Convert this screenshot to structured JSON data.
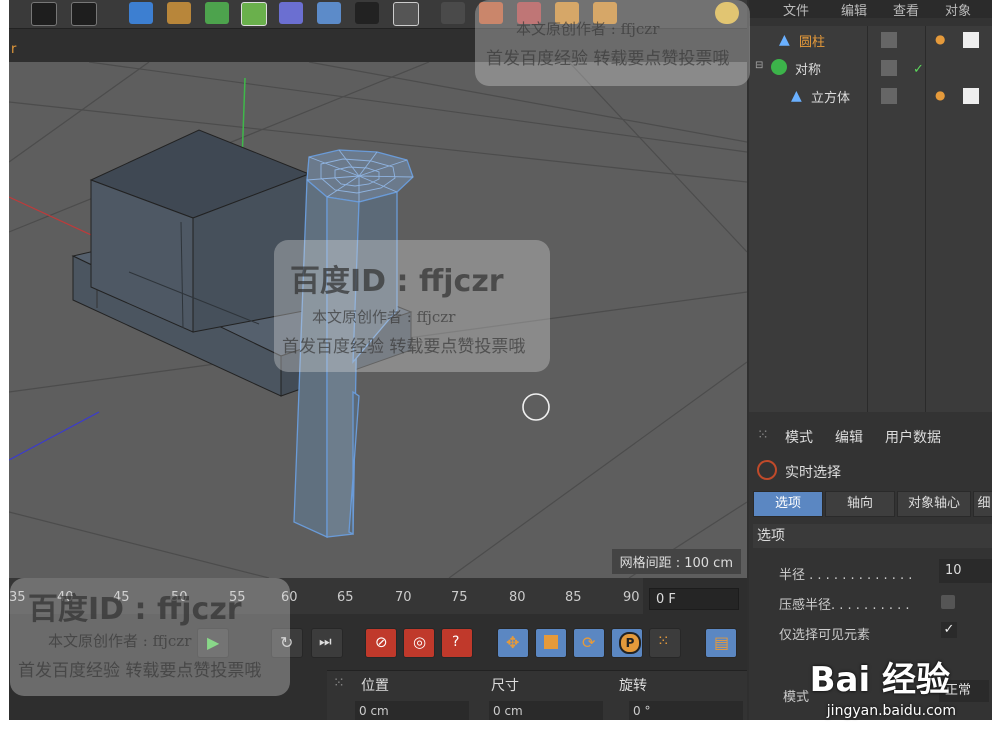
{
  "viewport": {
    "label": "r",
    "grid_spacing_text": "网格间距 : 100 cm"
  },
  "object_manager": {
    "menu": [
      "文件",
      "编辑",
      "查看",
      "对象"
    ],
    "objects": [
      {
        "name": "圆柱",
        "highlighted": true,
        "indent": 1
      },
      {
        "name": "对称",
        "highlighted": false,
        "indent": 0
      },
      {
        "name": "立方体",
        "highlighted": false,
        "indent": 1
      }
    ]
  },
  "attributes": {
    "menu": [
      "模式",
      "编辑",
      "用户数据"
    ],
    "tool_title": "实时选择",
    "tabs": [
      "选项",
      "轴向",
      "对象轴心",
      "细"
    ],
    "section_title": "选项",
    "radius_label": "半径 . . . . . . . . . . . . .",
    "radius_value": "10",
    "pressure_label": "压感半径. . . . . . . . . .",
    "visible_only_label": "仅选择可见元素",
    "mode_label": "模式",
    "mode_value": "正常"
  },
  "timeline": {
    "ticks": [
      "35",
      "40",
      "45",
      "50",
      "55",
      "60",
      "65",
      "70",
      "75",
      "80",
      "85",
      "90"
    ],
    "current_frame": "0 F"
  },
  "coordinates": {
    "headers": [
      "位置",
      "尺寸",
      "旋转"
    ],
    "position_x": "0 cm",
    "size_x": "0 cm",
    "rotation_h": "0 °"
  },
  "watermark": {
    "title": "百度ID : ffjczr",
    "author": "本文原创作者 : ffjczr",
    "note": "首发百度经验 转载要点赞投票哦",
    "brand": "Bai 经验",
    "domain": "jingyan.baidu.com"
  },
  "colors": {
    "selection_blue": "#6a9bd8",
    "accent_orange": "#e59a3b",
    "tab_active": "#5b87c2"
  }
}
